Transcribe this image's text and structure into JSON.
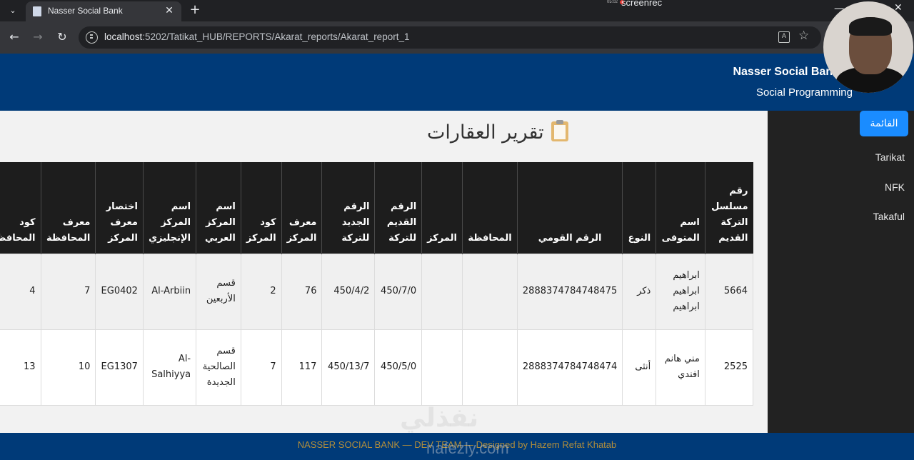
{
  "browser": {
    "tab_title": "Nasser Social Bank",
    "new_tab_symbol": "+",
    "close_symbol": "✕",
    "url_host": "localhost",
    "url_path": ":5202/Tatikat_HUB/REPORTS/Akarat_reports/Akarat_report_1",
    "recorder_label": "screenrec",
    "recorder_time": "05:02"
  },
  "header": {
    "brand": "Nasser Social Bank",
    "subtitle": "Social Programming"
  },
  "sidebar": {
    "items": [
      {
        "label": "القائمة",
        "active": true
      },
      {
        "label": "Tarikat"
      },
      {
        "label": "NFK"
      },
      {
        "label": "Takaful"
      }
    ]
  },
  "page": {
    "title": "تقرير العقارات",
    "title_icon": "clipboard-icon"
  },
  "table": {
    "headers": [
      "رقم مسلسل التركة القديم",
      "اسم المتوفى",
      "النوع",
      "الرقم القومي",
      "المحافظة",
      "المركز",
      "الرقم القديم للتركة",
      "الرقم الجديد للتركة",
      "معرف المركز",
      "كود المركز",
      "اسم المركز العربي",
      "اسم المركز الإنجليزي",
      "اختصار معرف المركز",
      "معرف المحافظة",
      "كود المحافظة"
    ],
    "rows": [
      [
        "5664",
        "ابراهيم ابراهيم ابراهيم",
        "ذكر",
        "2888374784748475",
        "",
        "",
        "450/7/0",
        "450/4/2",
        "76",
        "2",
        "قسم الأربعين",
        "Al-Arbiin",
        "EG0402",
        "7",
        "4"
      ],
      [
        "2525",
        "مني هانم افندي",
        "أنثى",
        "2888374784748474",
        "",
        "",
        "450/5/0",
        "450/13/7",
        "117",
        "7",
        "قسم الصالحية الجديدة",
        "Al-Salhiyya",
        "EG1307",
        "10",
        "13"
      ]
    ]
  },
  "footer": {
    "text": "NASSER SOCIAL BANK — DEV TEAM — Designed by Hazem Refat Khatab"
  },
  "watermark": {
    "arabic": "نفذلي",
    "latin": "nafezly.com"
  },
  "colors": {
    "header_bg": "#003a78",
    "sidebar_bg": "#222222",
    "active_button": "#1a8cff",
    "table_header_bg": "#1d1d1d",
    "footer_text": "#b08d3c"
  }
}
